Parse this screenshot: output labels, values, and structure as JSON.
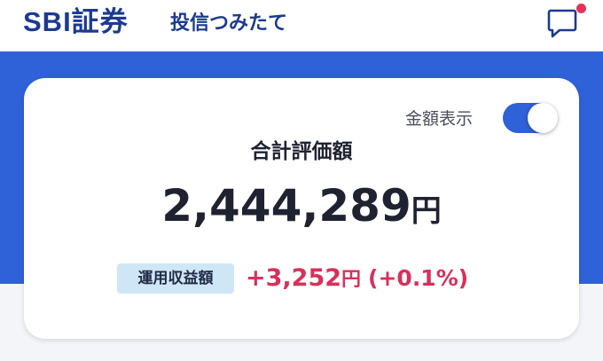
{
  "header": {
    "brand": "SBI証券",
    "product": "投信つみたて",
    "chat_icon": "chat-bubble-icon",
    "notification_color": "#e2345c"
  },
  "colors": {
    "brand": "#1d3a8f",
    "accent": "#2f61d8",
    "profit": "#d7315b",
    "badge_bg": "#cfe6f7"
  },
  "summary": {
    "toggle_label": "金額表示",
    "toggle_on": true,
    "total_label": "合計評価額",
    "total_value": "2,444,289",
    "total_unit": "円",
    "profit_label": "運用収益額",
    "profit_value": "+3,252",
    "profit_unit": "円",
    "profit_percent": "(+0.1%)"
  }
}
